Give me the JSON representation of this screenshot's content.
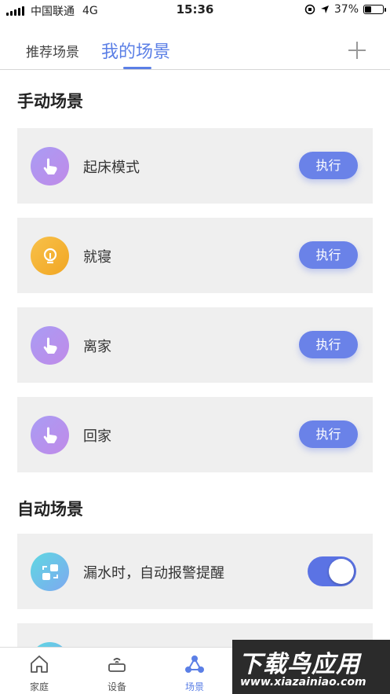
{
  "status_bar": {
    "carrier": "中国联通",
    "network": "4G",
    "time": "15:36",
    "battery": "37%",
    "battery_level": 0.37
  },
  "top_tabs": [
    {
      "label": "推荐场景",
      "active": false
    },
    {
      "label": "我的场景",
      "active": true
    }
  ],
  "manual_section": {
    "title": "手动场景",
    "scenes": [
      {
        "name": "起床模式",
        "icon": "hand-tap-icon",
        "button": "执行"
      },
      {
        "name": "就寝",
        "icon": "lightbulb-icon",
        "button": "执行"
      },
      {
        "name": "离家",
        "icon": "hand-tap-icon",
        "button": "执行"
      },
      {
        "name": "回家",
        "icon": "hand-tap-icon",
        "button": "执行"
      }
    ]
  },
  "auto_section": {
    "title": "自动场景",
    "scenes": [
      {
        "name": "漏水时，自动报警提醒",
        "icon": "automation-icon",
        "enabled": true
      }
    ]
  },
  "bottom_tabs": [
    {
      "label": "家庭",
      "icon": "home-icon",
      "active": false
    },
    {
      "label": "设备",
      "icon": "router-icon",
      "active": false
    },
    {
      "label": "场景",
      "icon": "scene-nodes-icon",
      "active": true
    }
  ],
  "watermark": {
    "title": "下载鸟应用",
    "url": "www.xiazainiao.com"
  },
  "colors": {
    "accent": "#5b7fe6",
    "button": "#6a82e8",
    "card_bg": "#efefef"
  }
}
